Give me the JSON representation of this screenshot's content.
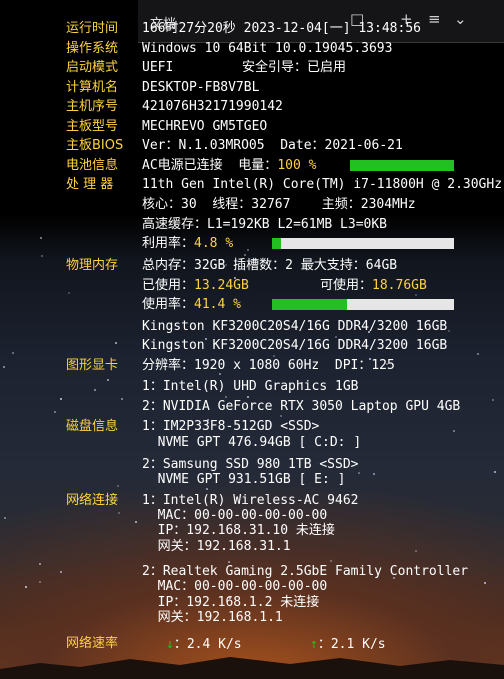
{
  "window": {
    "title": "文档",
    "controls": [
      "□",
      "+",
      "≡",
      "⌄"
    ]
  },
  "labels": {
    "runtime": "运行时间",
    "os": "操作系统",
    "boot": "启动模式",
    "computer_name": "计算机名",
    "host_serial": "主机序号",
    "board_model": "主板型号",
    "bios": "主板BIOS",
    "battery": "电池信息",
    "cpu": "处 理 器",
    "memory": "物理内存",
    "gpu": "图形显卡",
    "disk": "磁盘信息",
    "network": "网络连接",
    "net_speed": "网络速率"
  },
  "runtime": "166时27分20秒 2023-12-04[一] 13:48:56",
  "os": "Windows 10 64Bit 10.0.19045.3693",
  "boot": {
    "mode": "UEFI",
    "secure_boot": "安全引导：已启用"
  },
  "computer_name": "DESKTOP-FB8V7BL",
  "host_serial": "421076H32171990142",
  "board_model": "MECHREVO GM5TGEO",
  "bios": "Ver：N.1.03MRO05  Date：2021-06-21",
  "battery": {
    "prefix": "AC电源已连接  电量：",
    "value": "100 %",
    "level": 1.0
  },
  "cpu": {
    "name": "11th Gen Intel(R) Core(TM) i7-11800H @ 2.30GHz",
    "cores_line": "核心：30  线程：32767    主频：2304MHz",
    "cache_line": "高速缓存：L1=192KB L2=61MB L3=0KB",
    "usage_label": "利用率：",
    "usage_value": "4.8 %",
    "usage": 0.048
  },
  "memory": {
    "summary": "总内存：32GB 插槽数：2 最大支持：64GB",
    "used_label": "已使用：",
    "used_value": "13.24GB",
    "avail_label": "可使用：",
    "avail_value": "18.76GB",
    "usage_label": "使用率：",
    "usage_value": "41.4 %",
    "usage": 0.414,
    "modules": [
      "Kingston KF3200C20S4/16G DDR4/3200 16GB",
      "Kingston KF3200C20S4/16G DDR4/3200 16GB"
    ]
  },
  "gpu": {
    "resolution": "分辨率：1920 x 1080 60Hz  DPI：125",
    "cards": [
      "1：Intel(R) UHD Graphics 1GB",
      "2：NVIDIA GeForce RTX 3050 Laptop GPU 4GB"
    ]
  },
  "disks": [
    {
      "line1": "1：IM2P33F8-512GD <SSD>",
      "line2": "  NVME GPT 476.94GB [ C:D: ]"
    },
    {
      "line1": "2：Samsung SSD 980 1TB <SSD>",
      "line2": "  NVME GPT 931.51GB [ E: ]"
    }
  ],
  "networks": [
    {
      "name": "1：Intel(R) Wireless-AC 9462",
      "mac": "  MAC：00-00-00-00-00-00",
      "ip": "  IP：192.168.31.10 未连接",
      "gateway": "  网关：192.168.31.1"
    },
    {
      "name": "2：Realtek Gaming 2.5GbE Family Controller",
      "mac": "  MAC：00-00-00-00-00-00",
      "ip": "  IP：192.168.1.2 未连接",
      "gateway": "  网关：192.168.1.1"
    }
  ],
  "net_speed": {
    "down_icon": "↓",
    "down": "：2.4 K/s",
    "up_icon": "↑",
    "up": "：2.1 K/s"
  },
  "colors": {
    "label": "#ffd23f",
    "value": "#ffffff",
    "bar_fill": "#22c020",
    "bar_bg": "#e6e6e6"
  }
}
